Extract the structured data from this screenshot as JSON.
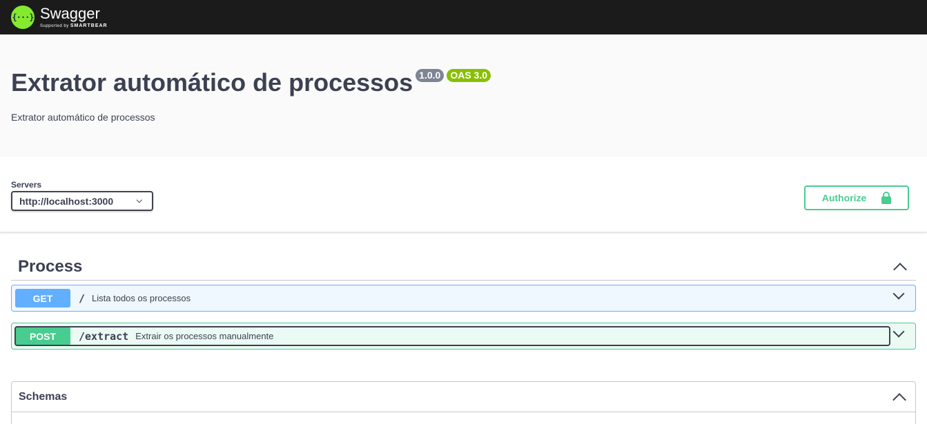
{
  "topbar": {
    "logo_mark": "{···}",
    "logo_name": "Swagger",
    "logo_sub_prefix": "Supported by",
    "logo_sub_brand": "SMARTBEAR"
  },
  "info": {
    "title": "Extrator automático de processos",
    "version_badge": "1.0.0",
    "oas_badge": "OAS 3.0",
    "description": "Extrator automático de processos"
  },
  "scheme": {
    "servers_label": "Servers",
    "selected_server": "http://localhost:3000",
    "authorize_label": "Authorize"
  },
  "tag": {
    "name": "Process",
    "operations": [
      {
        "method": "GET",
        "path": "/",
        "summary": "Lista todos os processos"
      },
      {
        "method": "POST",
        "path": "/extract",
        "summary": "Extrair os processos manualmente"
      }
    ]
  },
  "schemas": {
    "title": "Schemas"
  },
  "colors": {
    "get": "#61affe",
    "post": "#49cc90",
    "topbar": "#1b1b1b",
    "brand": "#85ea2d"
  }
}
